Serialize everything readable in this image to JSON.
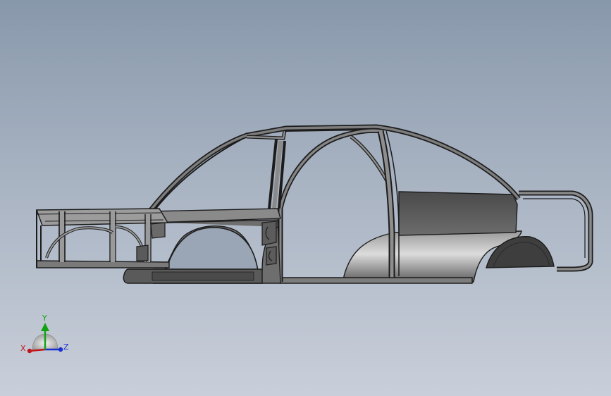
{
  "viewport": {
    "background_top": "#8898ab",
    "background_bottom": "#c9cfda"
  },
  "model": {
    "name": "car-body-frame",
    "edge_color": "#1c1c1c",
    "face_dark": "#4f4f4f",
    "face_mid": "#7a7a7a",
    "face_light": "#b5b5b5"
  },
  "triad": {
    "x_label": "X",
    "y_label": "Y",
    "z_label": "Z",
    "x_color": "#c0151b",
    "y_color": "#13a213",
    "z_color": "#1a2fd0"
  }
}
